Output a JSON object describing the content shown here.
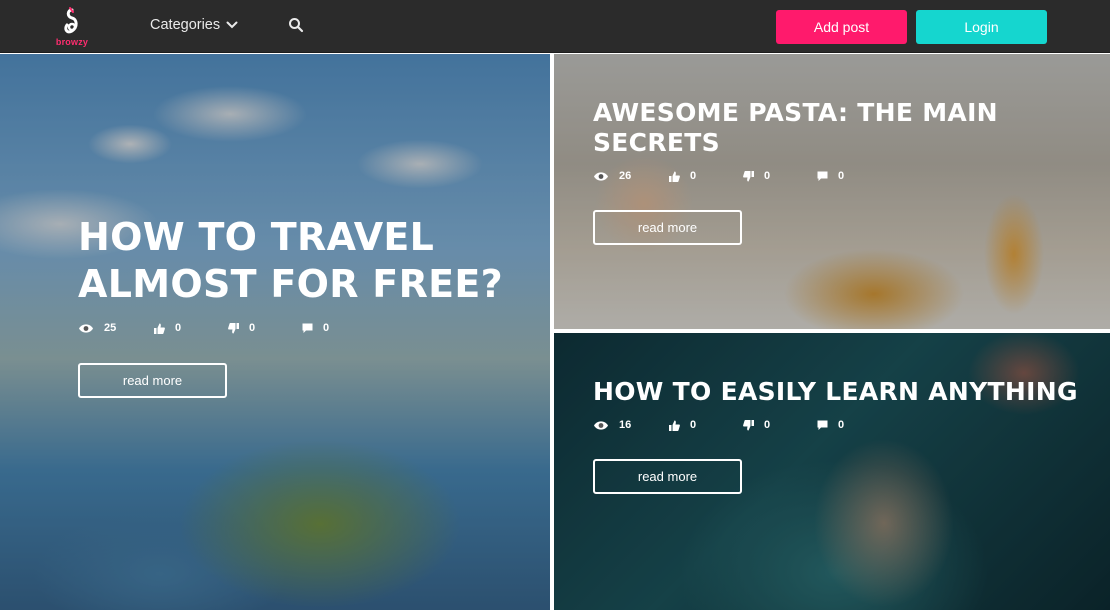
{
  "header": {
    "logo_text": "browzy",
    "categories_label": "Categories",
    "add_post_label": "Add post",
    "login_label": "Login"
  },
  "posts": [
    {
      "title_line1": "HOW TO TRAVEL",
      "title_line2": "ALMOST FOR FREE?",
      "views": "25",
      "likes": "0",
      "dislikes": "0",
      "comments": "0",
      "read_more": "read more"
    },
    {
      "title_line1": "AWESOME PASTA: THE MAIN",
      "title_line2": "SECRETS",
      "views": "26",
      "likes": "0",
      "dislikes": "0",
      "comments": "0",
      "read_more": "read more"
    },
    {
      "title_line1": "HOW TO EASILY LEARN ANYTHING",
      "views": "16",
      "likes": "0",
      "dislikes": "0",
      "comments": "0",
      "read_more": "read more"
    }
  ],
  "icons": {
    "views": "eye-icon",
    "likes": "thumbs-up-icon",
    "dislikes": "thumbs-down-icon",
    "comments": "comment-icon",
    "search": "search-icon",
    "dropdown": "chevron-down-icon"
  },
  "colors": {
    "header_bg": "#2b2b2b",
    "add_post": "#ff1a6c",
    "login": "#15d6cf",
    "brand": "#ff2d6f"
  }
}
